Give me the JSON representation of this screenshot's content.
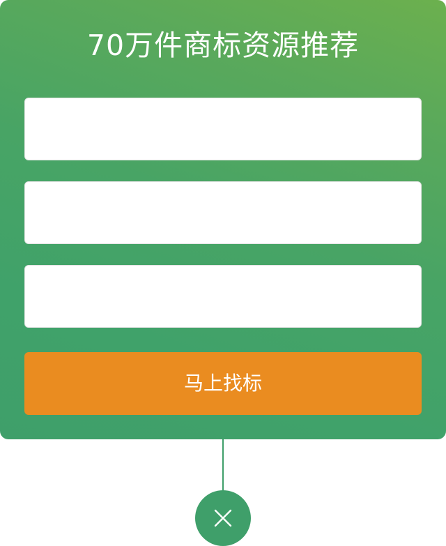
{
  "form": {
    "title": "70万件商标资源推荐",
    "fields": [
      {
        "value": "",
        "placeholder": ""
      },
      {
        "value": "",
        "placeholder": ""
      },
      {
        "value": "",
        "placeholder": ""
      }
    ],
    "submit_label": "马上找标"
  },
  "close": {
    "icon": "close-icon"
  },
  "colors": {
    "card_gradient_start": "#6cb04e",
    "card_gradient_end": "#3f9f6a",
    "button": "#ea8c20",
    "close_circle": "#3f9f6a",
    "text_light": "#ffffff"
  }
}
